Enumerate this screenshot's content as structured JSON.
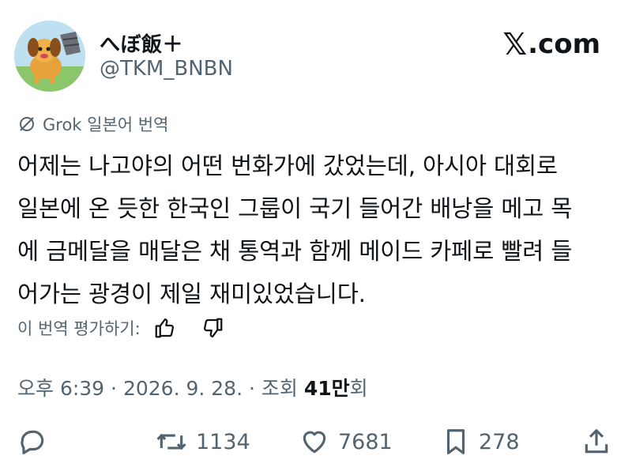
{
  "author": {
    "display_name": "へぼ飯＋",
    "handle": "@TKM_BNBN",
    "avatar_icon": "dog-avatar-icon"
  },
  "brand": {
    "label": ".com",
    "glyph": "𝕏"
  },
  "translation": {
    "label": "Grok 일본어 번역"
  },
  "post": {
    "lines": [
      "어제는 나고야의 어떤 번화가에 갔었는데, 아시아 대회로",
      "일본에 온 듯한 한국인 그룹이 국기 들어간 배낭을 메고 목",
      "에 금메달을 매달은 채 통역과 함께 메이드 카페로 빨려 들",
      "어가는 광경이 제일 재미있었습니다."
    ]
  },
  "rating": {
    "label": "이 번역 평가하기:"
  },
  "meta": {
    "time": "오후 6:39",
    "date": "2026. 9. 28.",
    "separator": "·",
    "views_label": "조회",
    "views_number": "41만",
    "views_suffix": "회"
  },
  "stats": {
    "reposts": "1134",
    "likes": "7681",
    "bookmarks": "278"
  },
  "colors": {
    "text_primary": "#0f1419",
    "text_secondary": "#536471",
    "background": "#ffffff"
  }
}
